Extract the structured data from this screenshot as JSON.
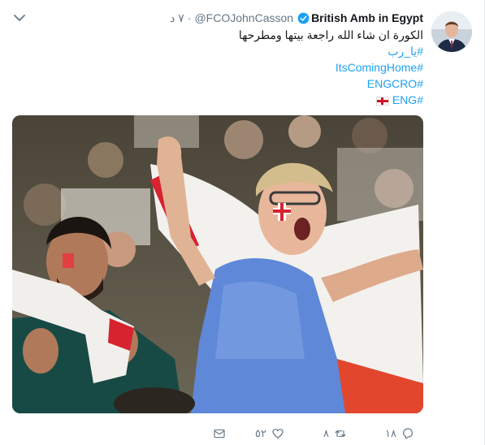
{
  "tweet": {
    "author_name": "British Amb in Egypt",
    "handle": "@FCOJohnCasson",
    "separator": "·",
    "time": "٧ د",
    "text_line": "الكورة ان شاء الله راجعة بيتها ومطرحها",
    "hashtags": [
      "#يا_رب",
      "#ItsComingHome",
      "#ENGCRO",
      "#ENG"
    ]
  },
  "actions": {
    "reply_count": "١٨",
    "retweet_count": "٨",
    "like_count": "٥٢"
  },
  "colors": {
    "link": "#1da1f2",
    "muted": "#657786",
    "text": "#14171a"
  },
  "icons": [
    "chevron-down-icon",
    "verified-badge-icon",
    "reply-icon",
    "retweet-icon",
    "heart-icon",
    "direct-message-icon",
    "england-flag-emoji"
  ]
}
